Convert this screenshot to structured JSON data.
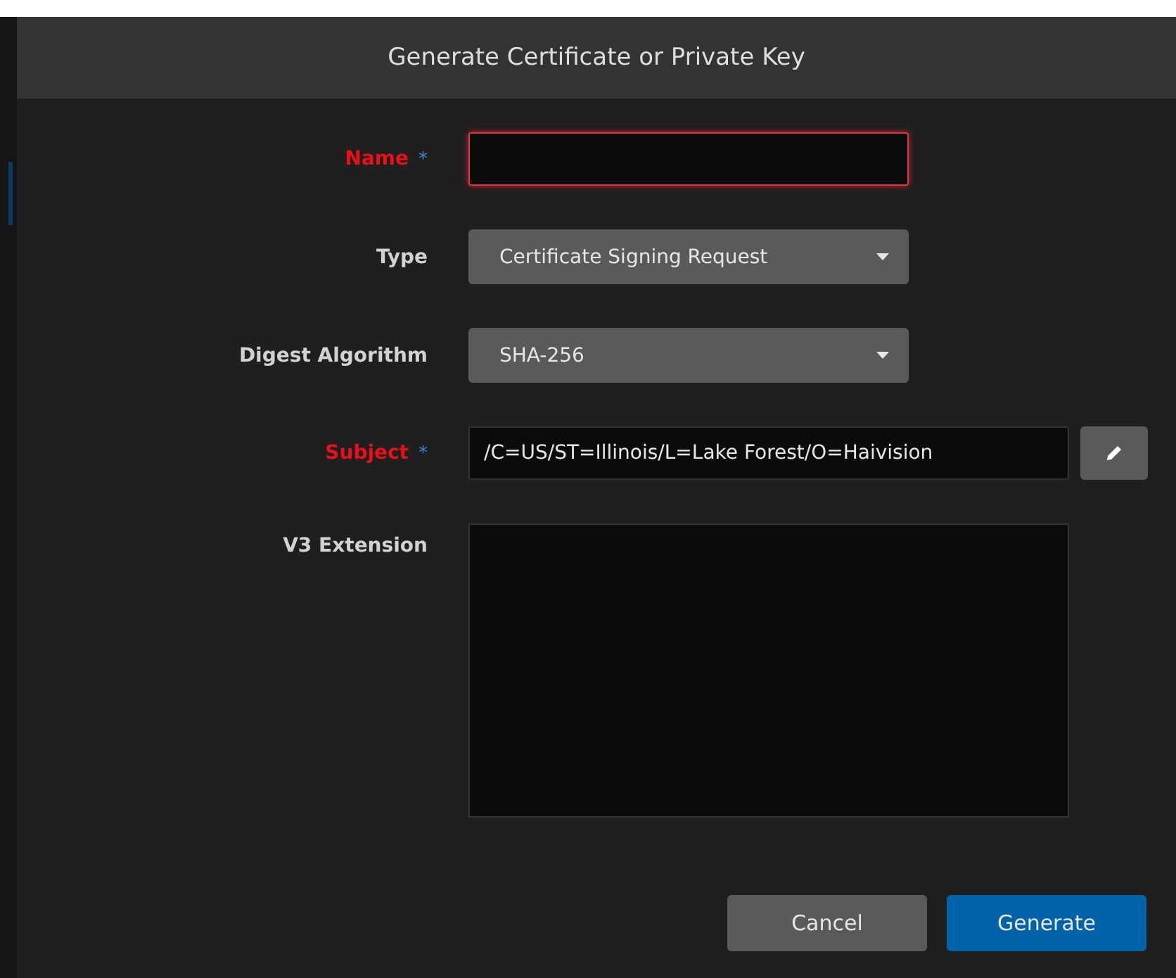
{
  "dialog": {
    "title": "Generate Certificate or Private Key",
    "fields": [
      {
        "kind": "text",
        "label": "Name",
        "required": true,
        "invalid": true
      },
      {
        "kind": "select",
        "label": "Type",
        "required": false,
        "invalid": false,
        "value": "Certificate Signing Request"
      },
      {
        "kind": "select",
        "label": "Digest Algorithm",
        "required": false,
        "invalid": false,
        "value": "SHA-256"
      },
      {
        "kind": "text-edit",
        "label": "Subject",
        "required": true,
        "invalid": true,
        "value": "/C=US/ST=Illinois/L=Lake Forest/O=Haivision"
      },
      {
        "kind": "textarea",
        "label": "V3 Extension",
        "required": false,
        "invalid": false
      }
    ],
    "required_mark": "*",
    "buttons": [
      {
        "label": "Cancel",
        "primary": false
      },
      {
        "label": "Generate",
        "primary": true
      }
    ]
  }
}
